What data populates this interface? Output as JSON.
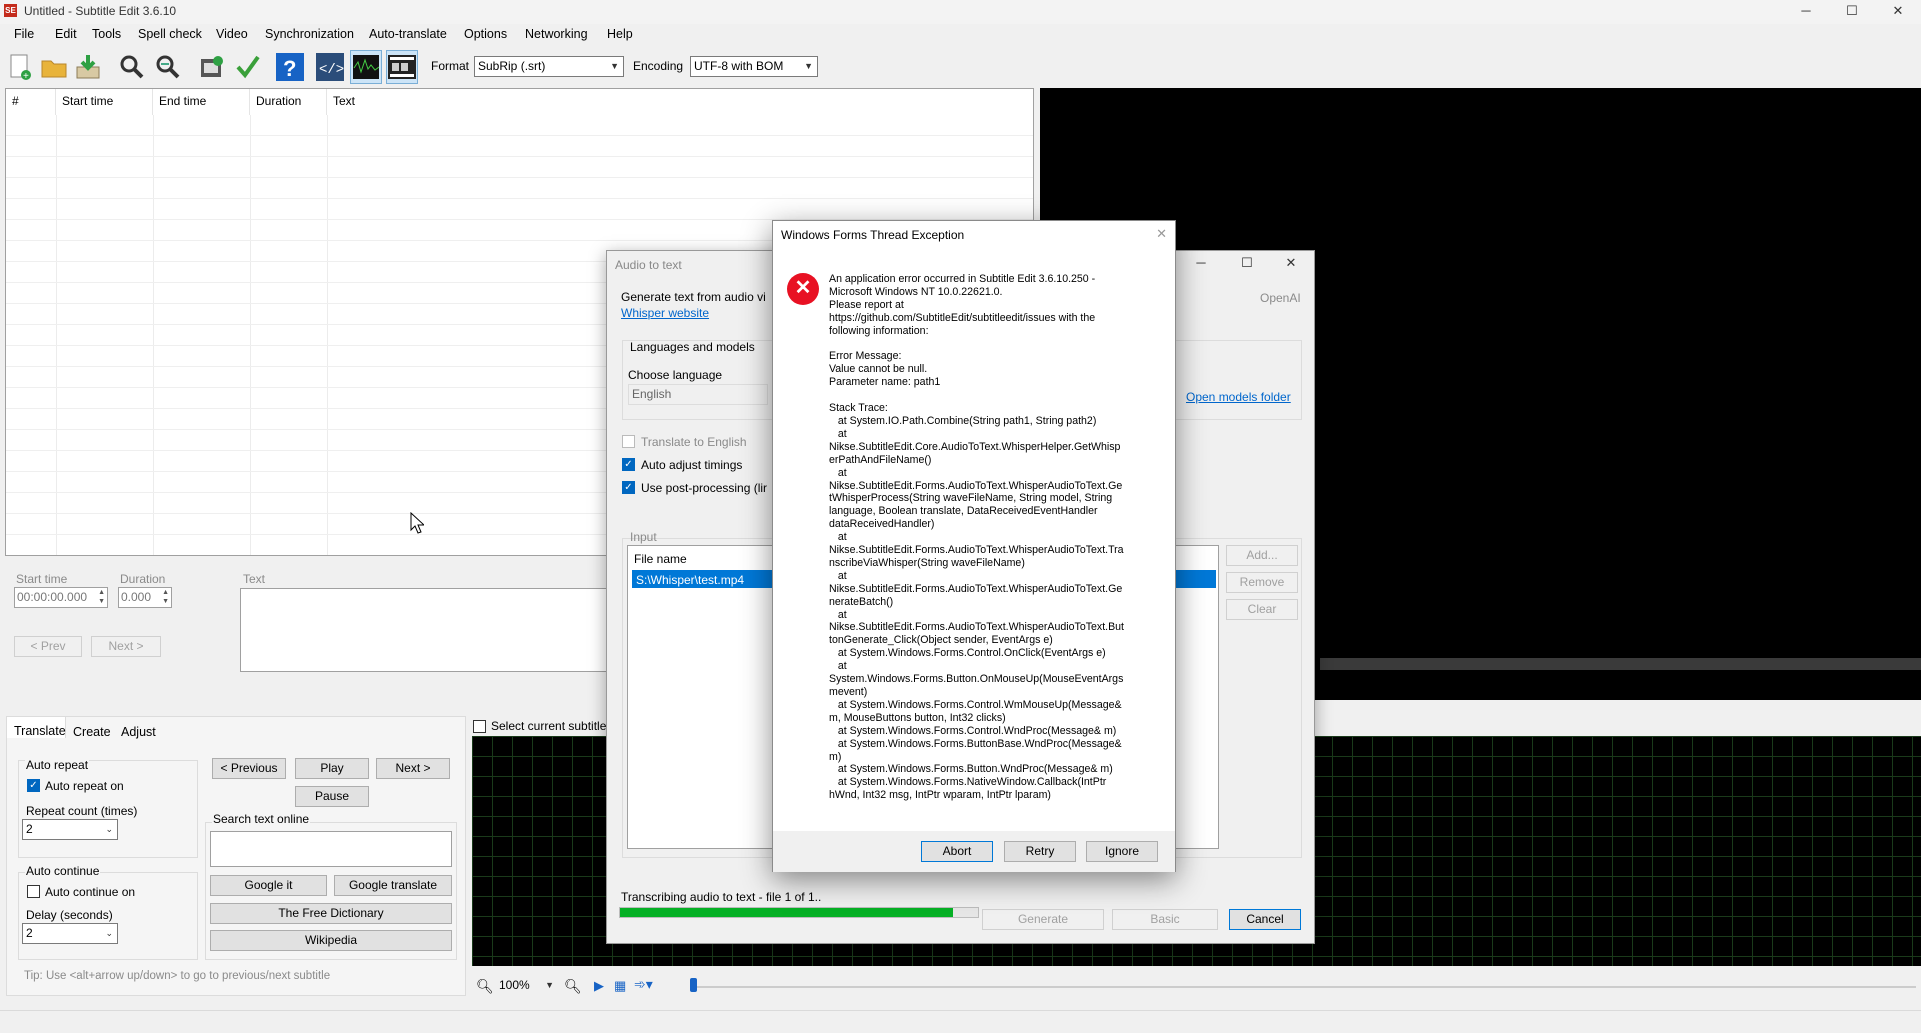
{
  "window": {
    "title": "Untitled - Subtitle Edit 3.6.10",
    "minimize": "─",
    "maximize": "☐",
    "close": "✕"
  },
  "menu": [
    "File",
    "Edit",
    "Tools",
    "Spell check",
    "Video",
    "Synchronization",
    "Auto-translate",
    "Options",
    "Networking",
    "Help"
  ],
  "toolbar": {
    "icons": [
      "new-file-icon",
      "open-folder-icon",
      "save-download-icon",
      "find-icon",
      "replace-icon",
      "import-video-icon",
      "spell-check-icon",
      "help-icon",
      "source-view-icon",
      "waveform-icon",
      "video-frames-icon"
    ],
    "format_label": "Format",
    "format_value": "SubRip (.srt)",
    "encoding_label": "Encoding",
    "encoding_value": "UTF-8 with BOM"
  },
  "grid": {
    "columns": [
      "#",
      "Start time",
      "End time",
      "Duration",
      "Text"
    ]
  },
  "editor": {
    "start_time_label": "Start time",
    "start_time_value": "00:00:00.000",
    "duration_label": "Duration",
    "duration_value": "0.000",
    "text_label": "Text",
    "prev_button": "< Prev",
    "next_button": "Next >"
  },
  "bottom": {
    "tabs": [
      "Translate",
      "Create",
      "Adjust"
    ],
    "auto_repeat_title": "Auto repeat",
    "auto_repeat_on": "Auto repeat on",
    "repeat_count_label": "Repeat count (times)",
    "repeat_count_value": "2",
    "auto_continue_title": "Auto continue",
    "auto_continue_on": "Auto continue on",
    "delay_label": "Delay (seconds)",
    "delay_value": "2",
    "previous_btn": "< Previous",
    "play_btn": "Play",
    "next_btn": "Next >",
    "pause_btn": "Pause",
    "search_label": "Search text online",
    "google_it": "Google it",
    "google_translate": "Google translate",
    "free_dictionary": "The Free Dictionary",
    "wikipedia": "Wikipedia",
    "tip": "Tip: Use <alt+arrow up/down> to go to previous/next subtitle",
    "select_current": "Select current subtitle",
    "zoom_value": "100%"
  },
  "audio_dialog": {
    "title": "Audio to text",
    "generate_text": "Generate text from audio vi",
    "whisper_link": "Whisper website",
    "engine": "OpenAI",
    "languages_group": "Languages and models",
    "choose_language": "Choose language",
    "language_value": "English",
    "open_models_folder": "Open models folder",
    "translate_to_english": "Translate to English",
    "auto_adjust_timings": "Auto adjust timings",
    "use_post_processing": "Use post-processing (lir",
    "input_group": "Input",
    "file_name_header": "File name",
    "file_name_value": "S:\\Whisper\\test.mp4",
    "add_btn": "Add...",
    "remove_btn": "Remove",
    "clear_btn": "Clear",
    "progress_text": "Transcribing audio to text - file 1 of 1..",
    "progress_value": 0.93,
    "generate_btn": "Generate",
    "basic_btn": "Basic",
    "cancel_btn": "Cancel"
  },
  "error_dialog": {
    "title": "Windows Forms Thread Exception",
    "message": "An application error occurred in Subtitle Edit 3.6.10.250 -\nMicrosoft Windows NT 10.0.22621.0.\nPlease report at\nhttps://github.com/SubtitleEdit/subtitleedit/issues with the\nfollowing information:\n\nError Message:\nValue cannot be null.\nParameter name: path1\n\nStack Trace:\n   at System.IO.Path.Combine(String path1, String path2)\n   at\nNikse.SubtitleEdit.Core.AudioToText.WhisperHelper.GetWhisp\nerPathAndFileName()\n   at\nNikse.SubtitleEdit.Forms.AudioToText.WhisperAudioToText.Ge\ntWhisperProcess(String waveFileName, String model, String\nlanguage, Boolean translate, DataReceivedEventHandler\ndataReceivedHandler)\n   at\nNikse.SubtitleEdit.Forms.AudioToText.WhisperAudioToText.Tra\nnscribeViaWhisper(String waveFileName)\n   at\nNikse.SubtitleEdit.Forms.AudioToText.WhisperAudioToText.Ge\nnerateBatch()\n   at\nNikse.SubtitleEdit.Forms.AudioToText.WhisperAudioToText.But\ntonGenerate_Click(Object sender, EventArgs e)\n   at System.Windows.Forms.Control.OnClick(EventArgs e)\n   at\nSystem.Windows.Forms.Button.OnMouseUp(MouseEventArgs\nmevent)\n   at System.Windows.Forms.Control.WmMouseUp(Message&\nm, MouseButtons button, Int32 clicks)\n   at System.Windows.Forms.Control.WndProc(Message& m)\n   at System.Windows.Forms.ButtonBase.WndProc(Message&\nm)\n   at System.Windows.Forms.Button.WndProc(Message& m)\n   at System.Windows.Forms.NativeWindow.Callback(IntPtr\nhWnd, Int32 msg, IntPtr wparam, IntPtr lparam)",
    "abort_btn": "Abort",
    "retry_btn": "Retry",
    "ignore_btn": "Ignore"
  },
  "colors": {
    "accent": "#0067c0",
    "progress": "#06b025",
    "error_red": "#e81123",
    "link": "#0066cc"
  }
}
